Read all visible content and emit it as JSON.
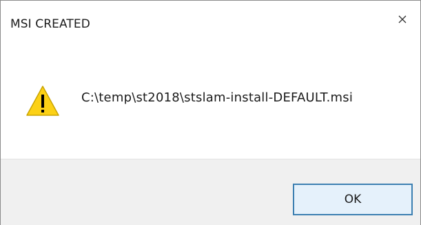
{
  "dialog": {
    "title": "MSI CREATED",
    "close_icon": "close-icon",
    "message": "C:\\temp\\st2018\\stslam-install-DEFAULT.msi",
    "warning_icon": "warning-icon",
    "ok_label": "OK"
  },
  "colors": {
    "warning_fill": "#fcd116",
    "warning_outline": "#c9a400",
    "button_border": "#3c7fb1",
    "button_bg": "#e5f1fb",
    "footer_bg": "#f0f0f0"
  }
}
